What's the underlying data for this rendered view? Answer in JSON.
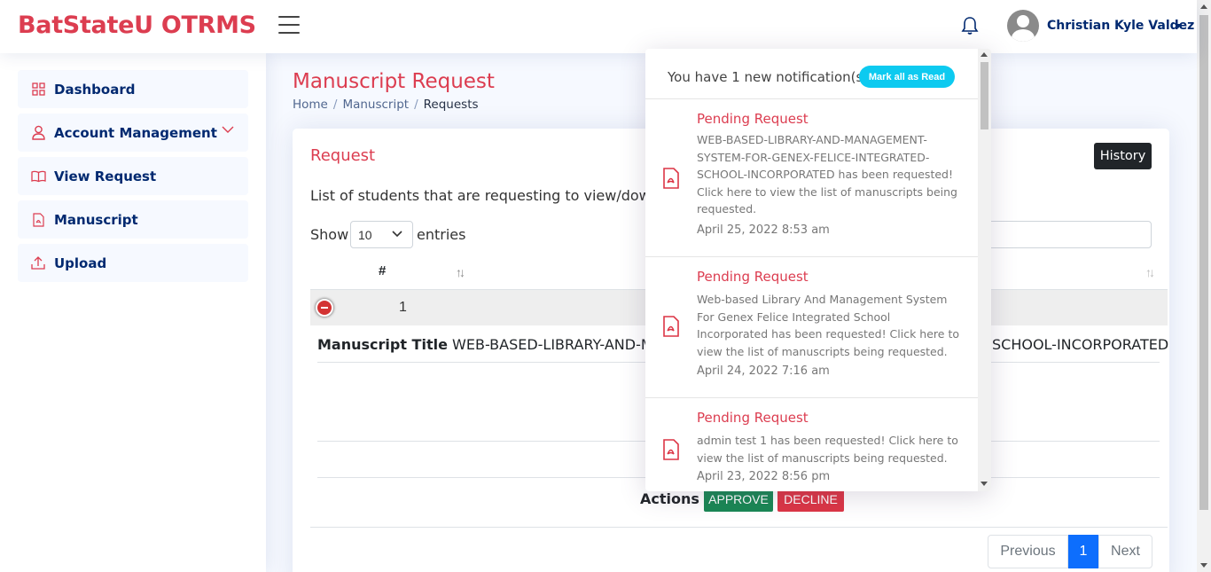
{
  "header": {
    "brand": "BatStateU OTRMS",
    "user_name": "Christian Kyle Valdez"
  },
  "sidebar": {
    "items": [
      {
        "label": "Dashboard",
        "icon": "grid-icon"
      },
      {
        "label": "Account Management",
        "icon": "person-icon"
      },
      {
        "label": "View Request",
        "icon": "book-icon"
      },
      {
        "label": "Manuscript",
        "icon": "file-pdf-icon"
      },
      {
        "label": "Upload",
        "icon": "upload-icon"
      }
    ]
  },
  "page": {
    "title": "Manuscript Request",
    "breadcrumb": [
      "Home",
      "Manuscript",
      "Requests"
    ]
  },
  "card": {
    "title": "Request",
    "history_label": "History",
    "description": "List of students that are requesting to view/downlo",
    "show_label": "Show",
    "entries_value": "10",
    "entries_label": "entries",
    "table": {
      "col_hash": "#",
      "row_number": "1",
      "detail_label": "Manuscript Title",
      "detail_value": "WEB-BASED-LIBRARY-AND-MAN",
      "detail_value_right": "SCHOOL-INCORPORATED"
    },
    "actions_label": "Actions",
    "approve_label": "APPROVE",
    "decline_label": "DECLINE",
    "pagination": {
      "previous": "Previous",
      "current": "1",
      "next": "Next"
    }
  },
  "notifications": {
    "header_text": "You have 1 new notification(s)",
    "mark_all_label": "Mark all as Read",
    "items": [
      {
        "title": "Pending Request",
        "message": "WEB-BASED-LIBRARY-AND-MANAGEMENT-SYSTEM-FOR-GENEX-FELICE-INTEGRATED-SCHOOL-INCORPORATED has been requested! Click here to view the list of manuscripts being requested.",
        "time": "April 25, 2022 8:53 am"
      },
      {
        "title": "Pending Request",
        "message": "Web-based Library And Management System For Genex Felice Integrated School Incorporated has been requested! Click here to view the list of manuscripts being requested.",
        "time": "April 24, 2022 7:16 am"
      },
      {
        "title": "Pending Request",
        "message": "admin test 1 has been requested! Click here to view the list of manuscripts being requested.",
        "time": "April 23, 2022 8:56 pm"
      }
    ]
  },
  "colors": {
    "brand": "#dc3d50",
    "navy": "#012970",
    "approve": "#198754",
    "decline": "#dc3545",
    "info": "#0dcaf0",
    "primary": "#0d6efd"
  }
}
